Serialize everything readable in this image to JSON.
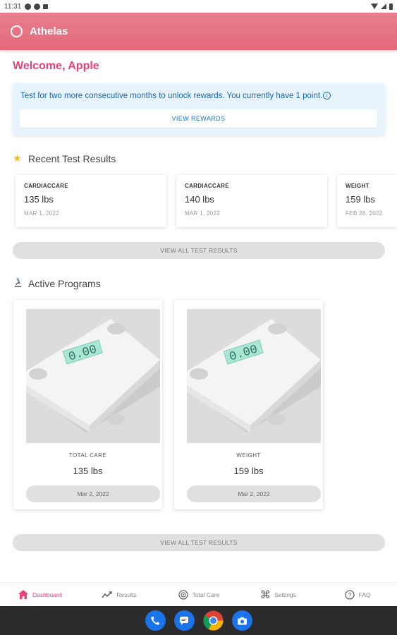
{
  "status_bar": {
    "time": "11:31"
  },
  "app_bar": {
    "title": "Athelas"
  },
  "welcome": "Welcome, Apple",
  "rewards": {
    "message": "Test for two more consecutive months to unlock rewards. You currently have 1 point.",
    "button_label": "VIEW REWARDS"
  },
  "recent_results": {
    "title": "Recent Test Results",
    "icon": "star-icon",
    "items": [
      {
        "type": "CARDIACCARE",
        "value": "135 lbs",
        "date": "MAR 1, 2022"
      },
      {
        "type": "CARDIACCARE",
        "value": "140 lbs",
        "date": "MAR 1, 2022"
      },
      {
        "type": "WEIGHT",
        "value": "159 lbs",
        "date": "FEB 28, 2022"
      }
    ],
    "view_all_label": "VIEW ALL TEST RESULTS"
  },
  "active_programs": {
    "title": "Active Programs",
    "icon": "microscope-icon",
    "items": [
      {
        "type": "TOTAL CARE",
        "value": "135 lbs",
        "date": "Mar 2, 2022",
        "scale_reading": "0.00"
      },
      {
        "type": "WEIGHT",
        "value": "159 lbs",
        "date": "Mar 2, 2022",
        "scale_reading": "0.00"
      }
    ],
    "view_all_label": "VIEW ALL TEST RESULTS"
  },
  "bottom_nav": [
    {
      "label": "Dashboard",
      "icon": "home-icon",
      "active": true
    },
    {
      "label": "Results",
      "icon": "trend-icon",
      "active": false
    },
    {
      "label": "Total Care",
      "icon": "target-icon",
      "active": false
    },
    {
      "label": "Settings",
      "icon": "command-icon",
      "active": false
    },
    {
      "label": "FAQ",
      "icon": "help-icon",
      "active": false
    }
  ],
  "colors": {
    "accent": "#e8417a",
    "app_bar": "#e3697b",
    "banner_bg": "#e8f4fd",
    "banner_text": "#1565c0"
  }
}
